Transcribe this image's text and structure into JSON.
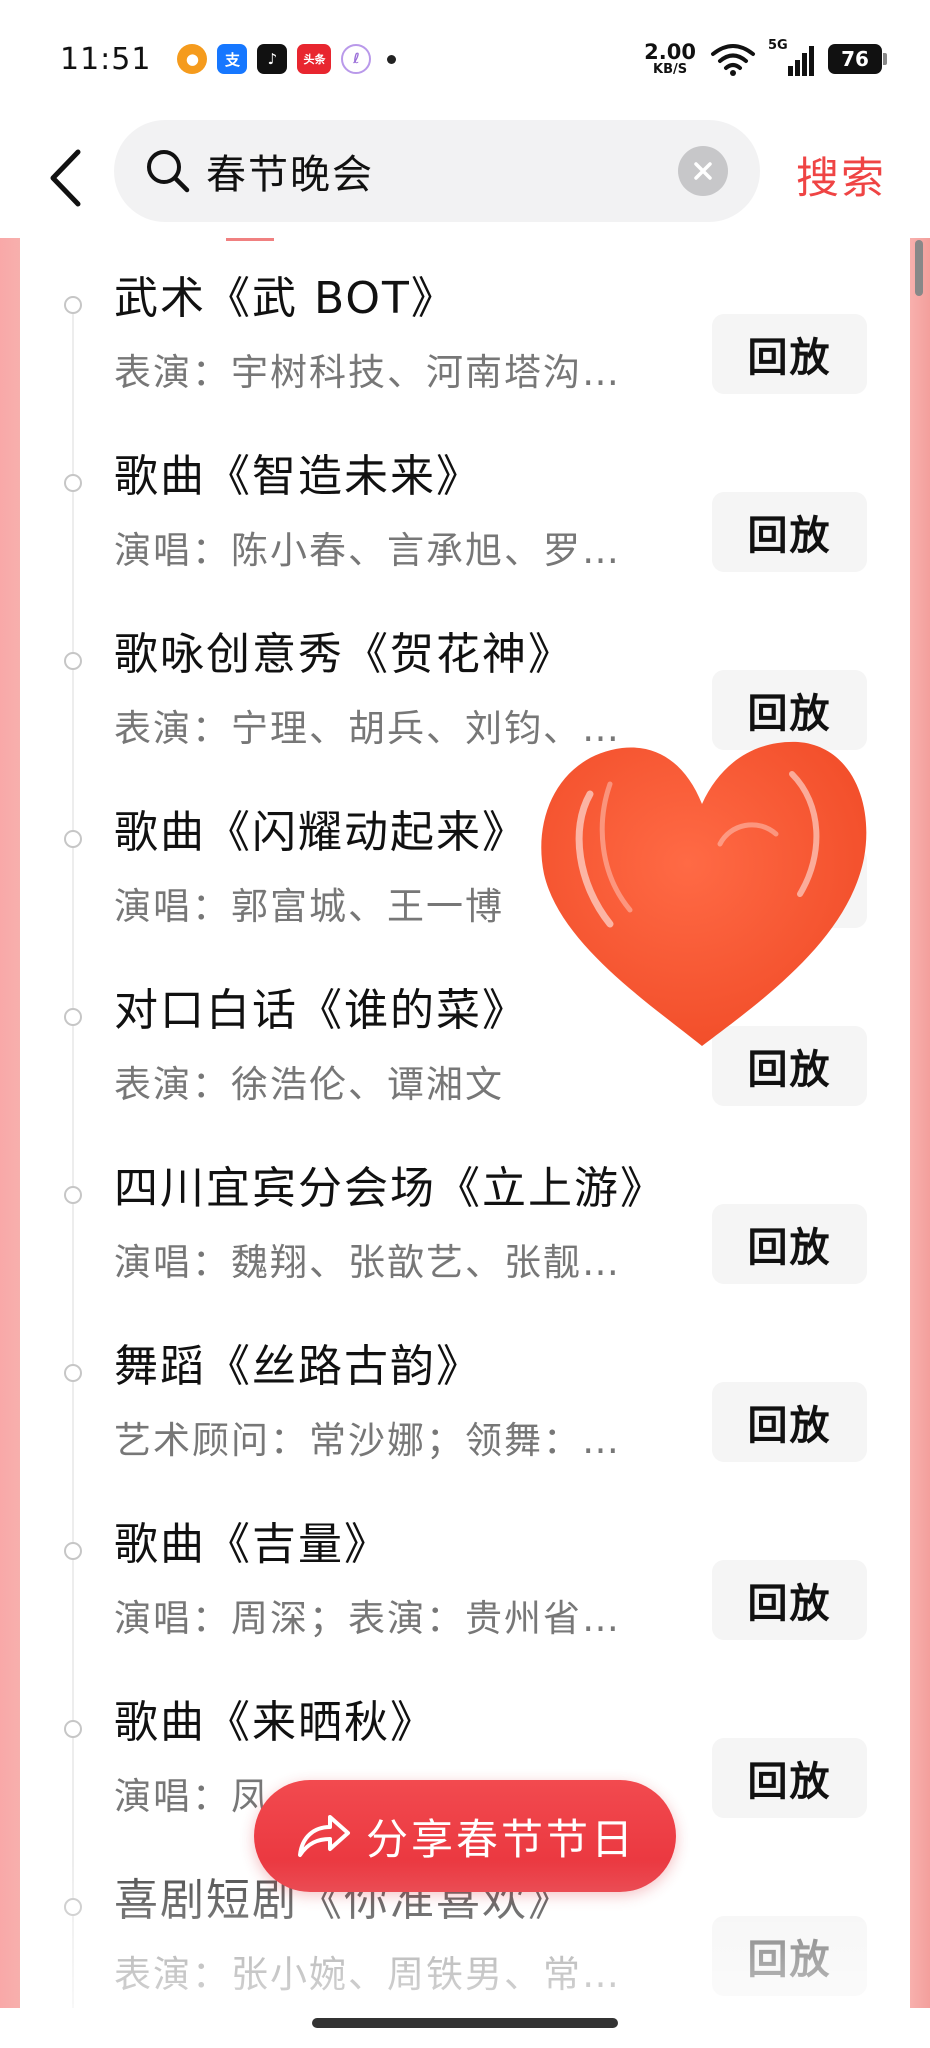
{
  "status_bar": {
    "time": "11:51",
    "notif_icons": [
      "app-icon-orange",
      "alipay-icon",
      "tiktok-icon",
      "toutiao-icon",
      "clip-icon"
    ],
    "alipay_glyph": "支",
    "toutiao_glyph": "头条",
    "net_speed_value": "2.00",
    "net_speed_unit": "KB/S",
    "network_type": "5G",
    "battery": "76"
  },
  "search": {
    "query": "春节晚会",
    "submit_label": "搜索"
  },
  "programs": [
    {
      "title": "武术《武 BOT》",
      "subtitle": "表演：宇树科技、河南塔沟…",
      "action": "回放"
    },
    {
      "title": "歌曲《智造未来》",
      "subtitle": "演唱：陈小春、言承旭、罗…",
      "action": "回放"
    },
    {
      "title": "歌咏创意秀《贺花神》",
      "subtitle": "表演：宁理、胡兵、刘钧、…",
      "action": "回放"
    },
    {
      "title": "歌曲《闪耀动起来》",
      "subtitle": "演唱：郭富城、王一博",
      "action": "回放"
    },
    {
      "title": "对口白话《谁的菜》",
      "subtitle": "表演：徐浩伦、谭湘文",
      "action": "回放"
    },
    {
      "title": "四川宜宾分会场《立上游》",
      "subtitle": "演唱：魏翔、张歆艺、张靓…",
      "action": "回放"
    },
    {
      "title": "舞蹈《丝路古韵》",
      "subtitle": "艺术顾问：常沙娜；领舞：…",
      "action": "回放"
    },
    {
      "title": "歌曲《吉量》",
      "subtitle": "演唱：周深；表演：贵州省…",
      "action": "回放"
    },
    {
      "title": "歌曲《来晒秋》",
      "subtitle": "演唱：凤…",
      "action": "回放"
    },
    {
      "title": "喜剧短剧《你准喜欢》",
      "subtitle": "表演：张小婉、周铁男、常…",
      "action": "回放"
    }
  ],
  "share": {
    "label": "分享春节节日"
  },
  "colors": {
    "accent": "#ef4444",
    "frame_pink": "#f8b0ad",
    "heart": "#f4552f"
  }
}
